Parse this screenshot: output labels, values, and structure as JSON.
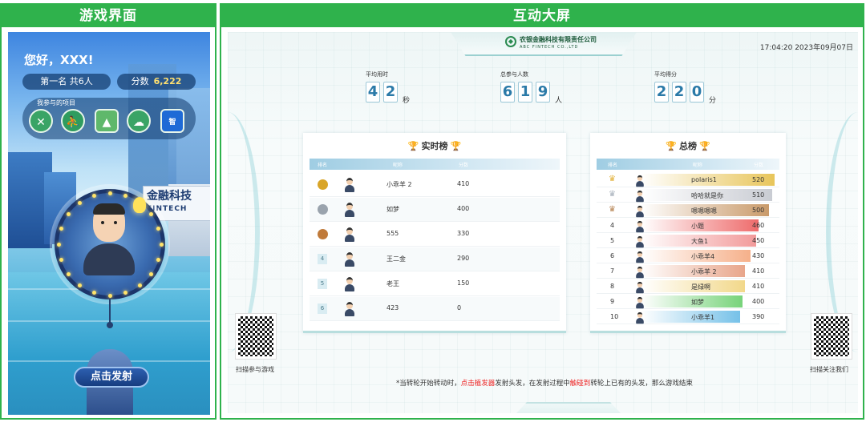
{
  "left_panel": {
    "title": "游戏界面",
    "greeting": "您好，XXX!",
    "rank_pill": "第一名  共6人",
    "score_label": "分数",
    "score_value": "6,222",
    "projects_label": "我参与的项目",
    "project_icons": [
      "fork-knife-icon",
      "runner-icon",
      "mountain-icon",
      "cloud-icon",
      "app-icon"
    ],
    "sign_text": "金融科技",
    "sign_sub": "FINTECH",
    "launch_button": "点击发射"
  },
  "right_panel": {
    "title": "互动大屏",
    "company_name": "农银金融科技有限责任公司",
    "company_en": "ABC FINTECH CO.,LTD",
    "datetime": "17:04:20 2023年09月07日",
    "stats": [
      {
        "label": "平均用时",
        "digits": [
          "4",
          "2"
        ],
        "unit": "秒"
      },
      {
        "label": "总参与人数",
        "digits": [
          "6",
          "1",
          "9"
        ],
        "unit": "人"
      },
      {
        "label": "平均得分",
        "digits": [
          "2",
          "2",
          "0"
        ],
        "unit": "分"
      }
    ],
    "realtime": {
      "title": "实时榜",
      "headers": [
        "排名",
        "昵称",
        "分数"
      ],
      "rows": [
        {
          "rank": "1",
          "name": "小乖羊 2",
          "score": "410",
          "medal": "gold"
        },
        {
          "rank": "2",
          "name": "如梦",
          "score": "400",
          "medal": "silver"
        },
        {
          "rank": "3",
          "name": "555",
          "score": "330",
          "medal": "bronze"
        },
        {
          "rank": "4",
          "name": "王二金",
          "score": "290"
        },
        {
          "rank": "5",
          "name": "老王",
          "score": "150"
        },
        {
          "rank": "6",
          "name": "423",
          "score": "0"
        }
      ]
    },
    "total": {
      "title": "总榜",
      "headers": [
        "排名",
        "昵称",
        "分数"
      ],
      "rows": [
        {
          "rank": "1",
          "name": "polaris1",
          "score": "520",
          "color": "#e8c55a",
          "fill": 1.0
        },
        {
          "rank": "2",
          "name": "哈哈就是你",
          "score": "510",
          "color": "#c9ccd3",
          "fill": 0.98
        },
        {
          "rank": "3",
          "name": "嗯嗯嗯嗯",
          "score": "500",
          "color": "#c99a6a",
          "fill": 0.96
        },
        {
          "rank": "4",
          "name": "小题",
          "score": "460",
          "color": "#ee6b6b",
          "fill": 0.88
        },
        {
          "rank": "5",
          "name": "大鱼1",
          "score": "450",
          "color": "#f29a9a",
          "fill": 0.86
        },
        {
          "rank": "6",
          "name": "小乖羊4",
          "score": "430",
          "color": "#f6b08a",
          "fill": 0.82
        },
        {
          "rank": "7",
          "name": "小乖羊 2",
          "score": "410",
          "color": "#e8a58a",
          "fill": 0.78
        },
        {
          "rank": "8",
          "name": "是绿啊",
          "score": "410",
          "color": "#f2d88a",
          "fill": 0.78
        },
        {
          "rank": "9",
          "name": "如梦",
          "score": "400",
          "color": "#77d37a",
          "fill": 0.76
        },
        {
          "rank": "10",
          "name": "小乖羊1",
          "score": "390",
          "color": "#76c1e8",
          "fill": 0.74
        }
      ]
    },
    "qr_left_label": "扫描参与游戏",
    "qr_right_label": "扫描关注我们",
    "notice_1": "*当转轮开始转动时，",
    "notice_red_1": "点击植发器",
    "notice_2": "发射头发，在发射过程中",
    "notice_red_2": "触碰到",
    "notice_3": "转轮上已有的头发，那么游戏结束"
  }
}
